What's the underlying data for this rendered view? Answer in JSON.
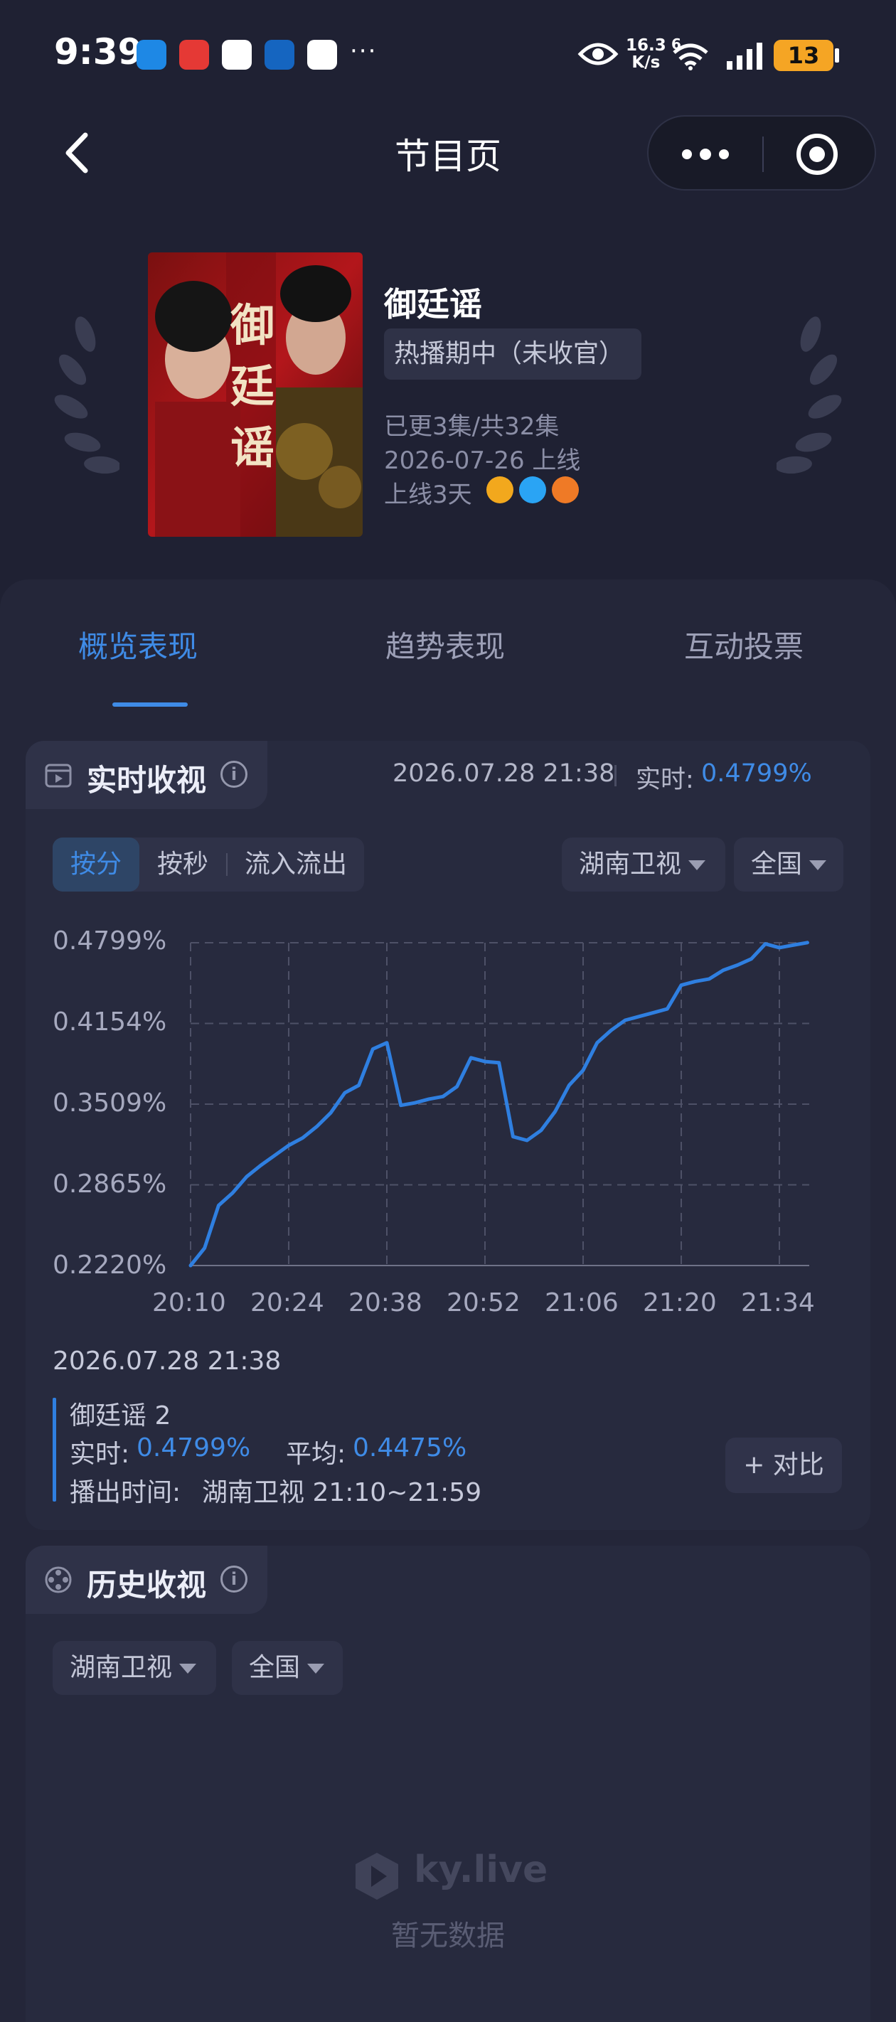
{
  "status_bar": {
    "time": "9:39",
    "net_speed_value": "16.3",
    "net_speed_unit": "K/s",
    "wifi_label": "6",
    "battery": "13",
    "more": "···"
  },
  "nav": {
    "title": "节目页"
  },
  "show": {
    "title": "御廷谣",
    "poster_text": "御廷谣",
    "status": "热播期中（未收官）",
    "episodes": "已更3集/共32集",
    "release": "2026-07-26 上线",
    "online_days": "上线3天"
  },
  "tabs": [
    {
      "label": "概览表现"
    },
    {
      "label": "趋势表现"
    },
    {
      "label": "互动投票"
    }
  ],
  "realtime": {
    "title": "实时收视",
    "timestamp": "2026.07.28 21:38",
    "realtime_label": "实时:",
    "realtime_value": "0.4799%",
    "segments": [
      "按分",
      "按秒",
      "流入流出"
    ],
    "channel": "湖南卫视",
    "region": "全国",
    "detail_time": "2026.07.28 21:38",
    "series_name": "御廷谣 2",
    "live_label": "实时:",
    "live_value": "0.4799%",
    "avg_label": "平均:",
    "avg_value": "0.4475%",
    "airtime_label": "播出时间:",
    "airtime_value": "湖南卫视 21:10~21:59",
    "compare": "+ 对比"
  },
  "chart_data": {
    "type": "line",
    "x_ticks": [
      "20:10",
      "20:24",
      "20:38",
      "20:52",
      "21:06",
      "21:20",
      "21:34"
    ],
    "y_ticks": [
      "0.4799%",
      "0.4154%",
      "0.3509%",
      "0.2865%",
      "0.2220%"
    ],
    "ylim": [
      0.222,
      0.4799
    ],
    "grid": true,
    "series": [
      {
        "color": "#2f7fe0",
        "x": [
          "20:10",
          "20:12",
          "20:14",
          "20:16",
          "20:18",
          "20:20",
          "20:22",
          "20:24",
          "20:26",
          "20:28",
          "20:30",
          "20:32",
          "20:34",
          "20:36",
          "20:38",
          "20:40",
          "20:42",
          "20:44",
          "20:46",
          "20:48",
          "20:50",
          "20:52",
          "20:54",
          "20:56",
          "20:58",
          "21:00",
          "21:02",
          "21:04",
          "21:06",
          "21:08",
          "21:10",
          "21:12",
          "21:14",
          "21:16",
          "21:18",
          "21:20",
          "21:22",
          "21:24",
          "21:26",
          "21:28",
          "21:30",
          "21:32",
          "21:34",
          "21:36",
          "21:38"
        ],
        "values": [
          0.222,
          0.236,
          0.27,
          0.28,
          0.293,
          0.302,
          0.31,
          0.318,
          0.324,
          0.333,
          0.344,
          0.36,
          0.366,
          0.395,
          0.4,
          0.35,
          0.352,
          0.355,
          0.357,
          0.365,
          0.388,
          0.385,
          0.384,
          0.325,
          0.322,
          0.33,
          0.345,
          0.366,
          0.378,
          0.4,
          0.41,
          0.418,
          0.421,
          0.424,
          0.427,
          0.446,
          0.449,
          0.451,
          0.458,
          0.462,
          0.467,
          0.479,
          0.476,
          0.478,
          0.48
        ]
      }
    ]
  },
  "history": {
    "title": "历史收视",
    "channel": "湖南卫视",
    "region": "全国",
    "watermark": "ky.live",
    "empty": "暂无数据"
  }
}
